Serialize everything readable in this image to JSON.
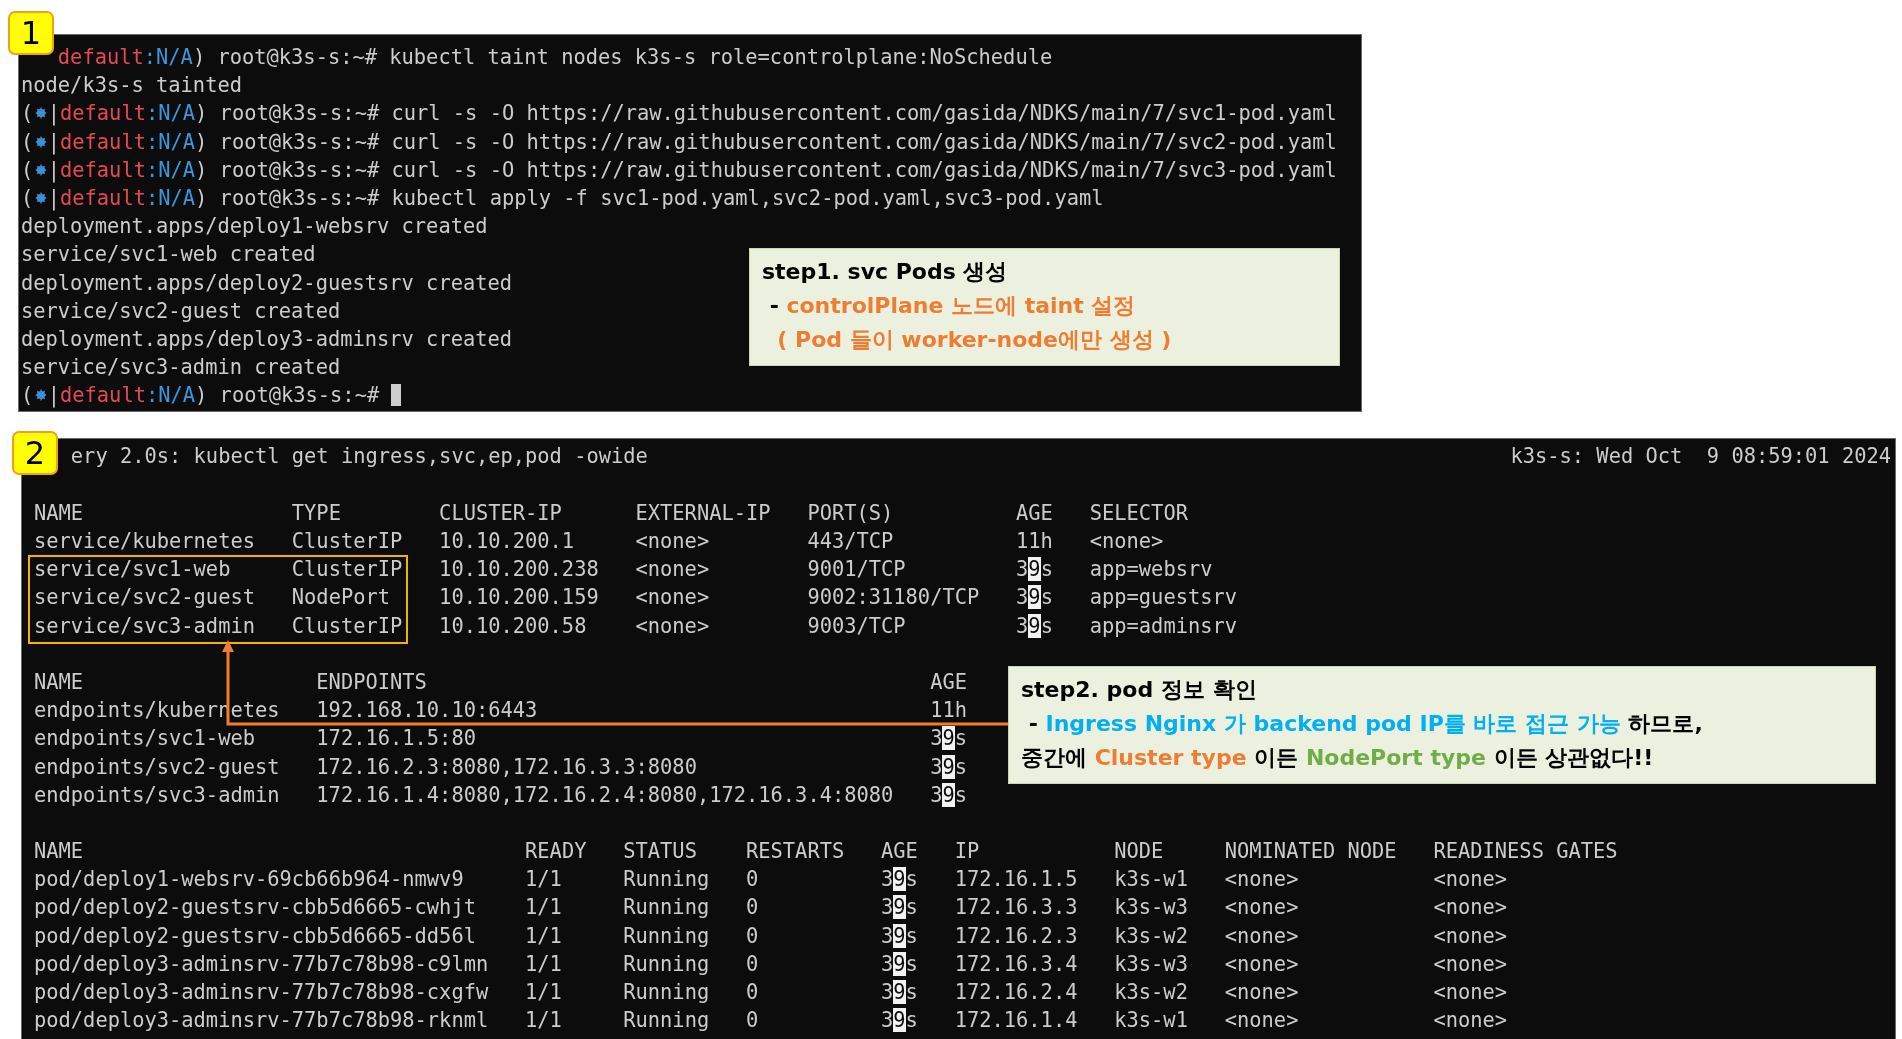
{
  "terminals": [
    {
      "badge": "1",
      "lines": [
        {
          "kind": "prompt",
          "context": "default",
          "namespace": ":N/A",
          "command": ") root@k3s-s:~# kubectl taint nodes k3s-s role=controlplane:NoSchedule"
        },
        {
          "kind": "output",
          "text": "node/k3s-s tainted"
        },
        {
          "kind": "prompt",
          "open": "(",
          "separator": "|",
          "context": "default",
          "namespace": ":N/A",
          "command": ") root@k3s-s:~# curl -s -O https://raw.githubusercontent.com/gasida/NDKS/main/7/svc1-pod.yaml"
        },
        {
          "kind": "prompt",
          "open": "(",
          "separator": "|",
          "context": "default",
          "namespace": ":N/A",
          "command": ") root@k3s-s:~# curl -s -O https://raw.githubusercontent.com/gasida/NDKS/main/7/svc2-pod.yaml"
        },
        {
          "kind": "prompt",
          "open": "(",
          "separator": "|",
          "context": "default",
          "namespace": ":N/A",
          "command": ") root@k3s-s:~# curl -s -O https://raw.githubusercontent.com/gasida/NDKS/main/7/svc3-pod.yaml"
        },
        {
          "kind": "prompt",
          "open": "(",
          "separator": "|",
          "context": "default",
          "namespace": ":N/A",
          "command": ") root@k3s-s:~# kubectl apply -f svc1-pod.yaml,svc2-pod.yaml,svc3-pod.yaml"
        },
        {
          "kind": "output",
          "text": "deployment.apps/deploy1-websrv created"
        },
        {
          "kind": "output",
          "text": "service/svc1-web created"
        },
        {
          "kind": "output",
          "text": "deployment.apps/deploy2-guestsrv created"
        },
        {
          "kind": "output",
          "text": "service/svc2-guest created"
        },
        {
          "kind": "output",
          "text": "deployment.apps/deploy3-adminsrv created"
        },
        {
          "kind": "output",
          "text": "service/svc3-admin created"
        },
        {
          "kind": "prompt",
          "open": "(",
          "separator": "|",
          "context": "default",
          "namespace": ":N/A",
          "command": ") root@k3s-s:~#",
          "cursor": true
        }
      ],
      "callout": {
        "lines": [
          [
            {
              "text": "step1. svc Pods 생성",
              "color": "#000000"
            }
          ],
          [
            {
              "text": " - ",
              "color": "#000000"
            },
            {
              "text": "controlPlane 노드에 taint 설정",
              "color": "#ed7d31"
            }
          ],
          [
            {
              "text": "  ( Pod 들이 worker-node에만 생성 )",
              "color": "#ed7d31"
            }
          ]
        ]
      }
    }
  ],
  "watch": {
    "badge": "2",
    "command": "ery 2.0s: kubectl get ingress,svc,ep,pod -owide",
    "clock": "k3s-s: Wed Oct  9 08:59:01 2024",
    "tables": [
      {
        "columns": [
          "NAME",
          "TYPE",
          "CLUSTER-IP",
          "EXTERNAL-IP",
          "PORT(S)",
          "AGE",
          "SELECTOR"
        ],
        "rows": [
          {
            "cells": [
              "service/kubernetes",
              "ClusterIP",
              "10.10.200.1",
              "<none>",
              "443/TCP",
              "11h",
              "<none>"
            ],
            "boxed": false
          },
          {
            "cells": [
              "service/svc1-web",
              "ClusterIP",
              "10.10.200.238",
              "<none>",
              "9001/TCP",
              {
                "text": "39s",
                "changed": true
              },
              "app=websrv"
            ],
            "boxed": true
          },
          {
            "cells": [
              "service/svc2-guest",
              "NodePort",
              "10.10.200.159",
              "<none>",
              "9002:31180/TCP",
              {
                "text": "39s",
                "changed": true
              },
              "app=guestsrv"
            ],
            "boxed": true
          },
          {
            "cells": [
              "service/svc3-admin",
              "ClusterIP",
              "10.10.200.58",
              "<none>",
              "9003/TCP",
              {
                "text": "39s",
                "changed": true
              },
              "app=adminsrv"
            ],
            "boxed": true
          }
        ]
      },
      {
        "columns": [
          "NAME",
          "ENDPOINTS",
          "AGE"
        ],
        "rows": [
          {
            "cells": [
              "endpoints/kubernetes",
              "192.168.10.10:6443",
              "11h"
            ]
          },
          {
            "cells": [
              "endpoints/svc1-web",
              "172.16.1.5:80",
              {
                "text": "39s",
                "changed": true
              }
            ]
          },
          {
            "cells": [
              "endpoints/svc2-guest",
              "172.16.2.3:8080,172.16.3.3:8080",
              {
                "text": "39s",
                "changed": true
              }
            ]
          },
          {
            "cells": [
              "endpoints/svc3-admin",
              "172.16.1.4:8080,172.16.2.4:8080,172.16.3.4:8080",
              {
                "text": "39s",
                "changed": true
              }
            ]
          }
        ]
      },
      {
        "columns": [
          "NAME",
          "READY",
          "STATUS",
          "RESTARTS",
          "AGE",
          "IP",
          "NODE",
          "NOMINATED NODE",
          "READINESS GATES"
        ],
        "rows": [
          {
            "cells": [
              "pod/deploy1-websrv-69cb66b964-nmwv9",
              "1/1",
              "Running",
              "0",
              {
                "text": "39s",
                "changed": true
              },
              "172.16.1.5",
              "k3s-w1",
              "<none>",
              "<none>"
            ]
          },
          {
            "cells": [
              "pod/deploy2-guestsrv-cbb5d6665-cwhjt",
              "1/1",
              "Running",
              "0",
              {
                "text": "39s",
                "changed": true
              },
              "172.16.3.3",
              "k3s-w3",
              "<none>",
              "<none>"
            ]
          },
          {
            "cells": [
              "pod/deploy2-guestsrv-cbb5d6665-dd56l",
              "1/1",
              "Running",
              "0",
              {
                "text": "39s",
                "changed": true
              },
              "172.16.2.3",
              "k3s-w2",
              "<none>",
              "<none>"
            ]
          },
          {
            "cells": [
              "pod/deploy3-adminsrv-77b7c78b98-c9lmn",
              "1/1",
              "Running",
              "0",
              {
                "text": "39s",
                "changed": true
              },
              "172.16.3.4",
              "k3s-w3",
              "<none>",
              "<none>"
            ]
          },
          {
            "cells": [
              "pod/deploy3-adminsrv-77b7c78b98-cxgfw",
              "1/1",
              "Running",
              "0",
              {
                "text": "39s",
                "changed": true
              },
              "172.16.2.4",
              "k3s-w2",
              "<none>",
              "<none>"
            ]
          },
          {
            "cells": [
              "pod/deploy3-adminsrv-77b7c78b98-rknml",
              "1/1",
              "Running",
              "0",
              {
                "text": "39s",
                "changed": true
              },
              "172.16.1.4",
              "k3s-w1",
              "<none>",
              "<none>"
            ]
          }
        ]
      }
    ],
    "callout": {
      "lines": [
        [
          {
            "text": "step2. pod 정보 확인",
            "color": "#000000"
          }
        ],
        [
          {
            "text": " - ",
            "color": "#000000"
          },
          {
            "text": "Ingress Nginx 가 backend pod IP를 바로 접근 가능",
            "color": "#00b0f0"
          },
          {
            "text": " 하므로,",
            "color": "#000000"
          }
        ],
        [
          {
            "text": "중간에 ",
            "color": "#000000"
          },
          {
            "text": "Cluster type",
            "color": "#ed7d31"
          },
          {
            "text": " 이든 ",
            "color": "#000000"
          },
          {
            "text": "NodePort type",
            "color": "#70ad47"
          },
          {
            "text": " 이든 상관없다!!",
            "color": "#000000"
          }
        ]
      ]
    }
  }
}
